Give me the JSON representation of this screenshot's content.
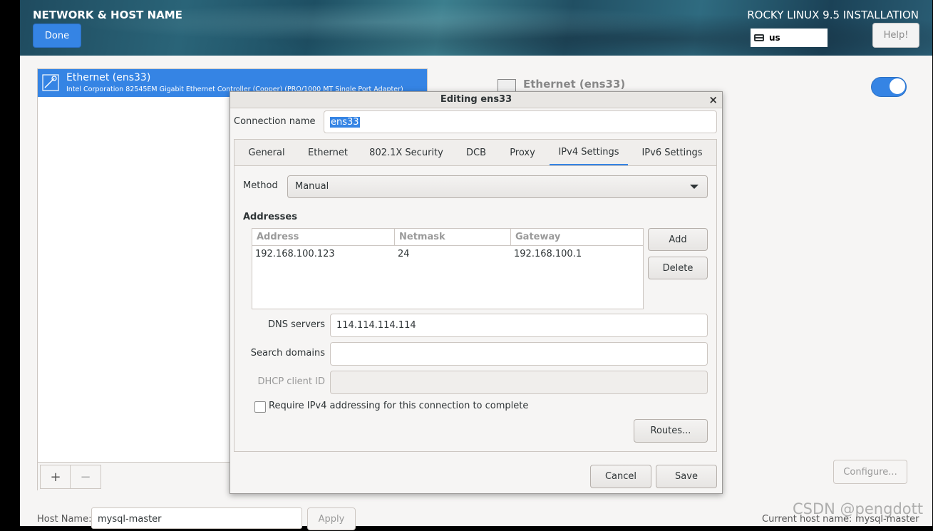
{
  "header": {
    "spoke_title": "NETWORK & HOST NAME",
    "done_label": "Done",
    "product_title": "ROCKY LINUX 9.5 INSTALLATION",
    "keyboard_layout": "us",
    "help_label": "Help!"
  },
  "devices": [
    {
      "name": "Ethernet (ens33)",
      "description": "Intel Corporation 82545EM Gigabit Ethernet Controller (Copper) (PRO/1000 MT Single Port Adapter)"
    }
  ],
  "toolbar": {
    "add_label": "+",
    "remove_label": "−"
  },
  "detail": {
    "title": "Ethernet (ens33)",
    "switch_on": true,
    "configure_label": "Configure..."
  },
  "hostname": {
    "label": "Host Name:",
    "value": "mysql-master",
    "apply_label": "Apply",
    "current_label": "Current host name:",
    "current_value": "mysql-master"
  },
  "dialog": {
    "title": "Editing ens33",
    "close_glyph": "×",
    "connection_name_label": "Connection name",
    "connection_name_value": "ens33",
    "tabs": [
      "General",
      "Ethernet",
      "802.1X Security",
      "DCB",
      "Proxy",
      "IPv4 Settings",
      "IPv6 Settings"
    ],
    "active_tab": "IPv4 Settings",
    "method_label": "Method",
    "method_value": "Manual",
    "addresses_heading": "Addresses",
    "columns": [
      "Address",
      "Netmask",
      "Gateway"
    ],
    "rows": [
      [
        "192.168.100.123",
        "24",
        "192.168.100.1"
      ]
    ],
    "add_label": "Add",
    "delete_label": "Delete",
    "dns_label": "DNS servers",
    "dns_value": "114.114.114.114",
    "search_label": "Search domains",
    "search_value": "",
    "dhcp_label": "DHCP client ID",
    "dhcp_value": "",
    "require_label": "Require IPv4 addressing for this connection to complete",
    "require_checked": false,
    "routes_label": "Routes...",
    "cancel_label": "Cancel",
    "save_label": "Save"
  },
  "watermark": "CSDN @pengdott",
  "colors": {
    "accent": "#3584e4",
    "background": "#f6f5f4"
  }
}
